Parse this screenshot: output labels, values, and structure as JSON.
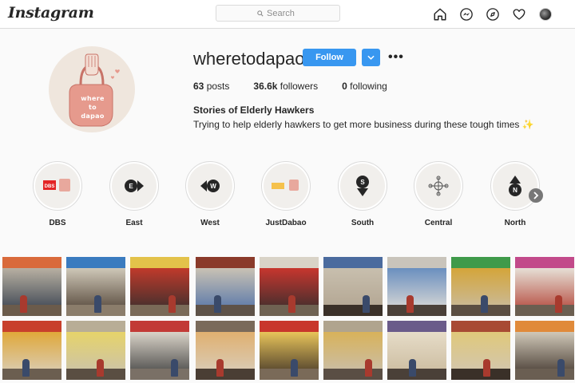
{
  "header": {
    "logo": "Instagram",
    "search_placeholder": "Search",
    "nav": [
      "home-icon",
      "messenger-icon",
      "explore-icon",
      "heart-icon",
      "profile-avatar"
    ]
  },
  "profile": {
    "username": "wheretodapao",
    "follow_label": "Follow",
    "stats": {
      "posts_count": "63",
      "posts_label": "posts",
      "followers_count": "36.6k",
      "followers_label": "followers",
      "following_count": "0",
      "following_label": "following"
    },
    "bio_name": "Stories of Elderly Hawkers",
    "bio_text": "Trying to help elderly hawkers to get more business during these tough times ✨",
    "avatar_text": "where to dapao"
  },
  "highlights": [
    {
      "label": "DBS"
    },
    {
      "label": "East"
    },
    {
      "label": "West"
    },
    {
      "label": "JustDabao"
    },
    {
      "label": "South"
    },
    {
      "label": "Central"
    },
    {
      "label": "North"
    }
  ],
  "colors": {
    "accent": "#3897f0",
    "avatar_bg": "#efe6dd",
    "avatar_bag": "#e69a8d"
  }
}
